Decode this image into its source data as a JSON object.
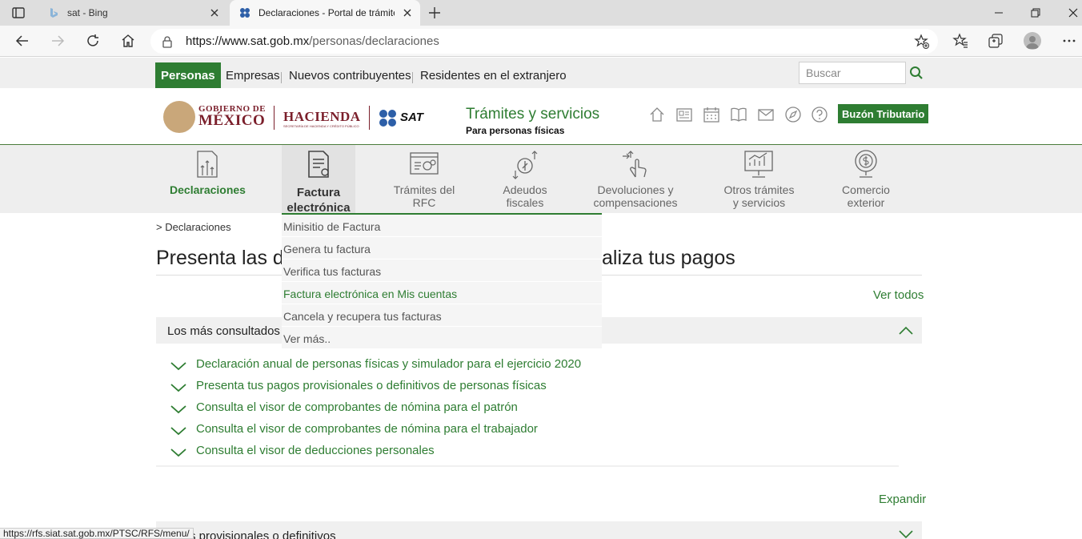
{
  "browser": {
    "tabs": [
      {
        "title": "sat - Bing",
        "favicon": "bing-icon",
        "active": false
      },
      {
        "title": "Declaraciones - Portal de trámite",
        "favicon": "sat-favicon",
        "active": true
      }
    ],
    "url_host": "https://www.sat.gob.mx",
    "url_path": "/personas/declaraciones",
    "status_url": "https://rfs.siat.sat.gob.mx/PTSC/RFS/menu/"
  },
  "audience": {
    "items": [
      "Personas",
      "Empresas",
      "Nuevos contribuyentes",
      "Residentes en el extranjero"
    ],
    "active": "Personas"
  },
  "search": {
    "placeholder": "Buscar"
  },
  "header": {
    "gob_line1": "GOBIERNO DE",
    "gob_line2": "MÉXICO",
    "hacienda": "HACIENDA",
    "hacienda_sub": "SECRETARÍA DE HACIENDA Y CRÉDITO PÚBLICO",
    "sat": "SAT",
    "site_title": "Trámites y servicios",
    "site_subtitle": "Para personas físicas",
    "icons": [
      "home-icon",
      "news-icon",
      "calendar-icon",
      "book-icon",
      "mail-icon",
      "compass-icon",
      "help-icon"
    ],
    "buzon": "Buzón Tributario"
  },
  "categories": [
    {
      "line1": "Declaraciones",
      "line2": "",
      "icon": "declaraciones-icon"
    },
    {
      "line1": "Factura",
      "line2": "electrónica",
      "icon": "factura-icon"
    },
    {
      "line1": "Trámites del",
      "line2": "RFC",
      "icon": "rfc-icon"
    },
    {
      "line1": "Adeudos",
      "line2": "fiscales",
      "icon": "adeudos-icon"
    },
    {
      "line1": "Devoluciones y",
      "line2": "compensaciones",
      "icon": "devoluciones-icon"
    },
    {
      "line1": "Otros trámites",
      "line2": "y servicios",
      "icon": "otros-icon"
    },
    {
      "line1": "Comercio",
      "line2": "exterior",
      "icon": "comercio-icon"
    }
  ],
  "dropdown": [
    "Minisitio de Factura",
    "Genera tu factura",
    "Verifica tus facturas",
    "Factura electrónica en Mis cuentas",
    "Cancela y recupera tus facturas",
    "Ver más.."
  ],
  "breadcrumb": "> Declaraciones",
  "page_title": "Presenta las declaraciones y realiza tus pagos",
  "page_title_visible_left": "Presenta las de",
  "page_title_visible_right": "aliza tus pagos",
  "ver_todos": "Ver todos",
  "section1": {
    "title": "Los más consultados",
    "items": [
      "Declaración anual de personas físicas y simulador para el ejercicio 2020",
      "Presenta tus pagos provisionales o definitivos de personas físicas",
      "Consulta el visor de comprobantes de nómina para el patrón",
      "Consulta el visor de comprobantes de nómina para el trabajador",
      "Consulta el visor de deducciones personales"
    ]
  },
  "expandir": "Expandir",
  "section2": {
    "title": "s provisionales o definitivos"
  },
  "colors": {
    "green": "#2e7d32",
    "maroon": "#7b1f2b"
  }
}
